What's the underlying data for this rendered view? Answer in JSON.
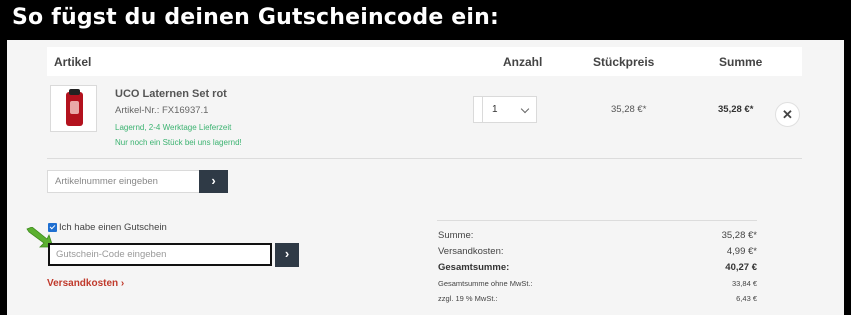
{
  "banner": {
    "title": "So fügst du deinen Gutscheincode ein:"
  },
  "table": {
    "headers": {
      "article": "Artikel",
      "quantity": "Anzahl",
      "unit_price": "Stückpreis",
      "total": "Summe"
    }
  },
  "item": {
    "name": "UCO Laternen Set rot",
    "article_number": "Artikel-Nr.: FX16937.1",
    "stock_status": "Lagernd, 2-4 Werktage Lieferzeit",
    "last_item_note": "Nur noch ein Stück bei uns lagernd!",
    "quantity": "1",
    "unit_price": "35,28 €*",
    "line_total": "35,28 €*",
    "remove_symbol": "✕"
  },
  "article_search": {
    "placeholder": "Artikelnummer eingeben",
    "button_symbol": "›"
  },
  "voucher": {
    "checkbox_label": "Ich habe einen Gutschein",
    "checked": true,
    "placeholder": "Gutschein-Code eingeben",
    "button_symbol": "›"
  },
  "shipping_link": "Versandkosten ›",
  "summary": [
    {
      "label": "Summe:",
      "value": "35,28 €*"
    },
    {
      "label": "Versandkosten:",
      "value": "4,99 €*"
    },
    {
      "label": "Gesamtsumme:",
      "value": "40,27 €"
    },
    {
      "label": "Gesamtsumme ohne MwSt.:",
      "value": "33,84 €"
    },
    {
      "label": "zzgl. 19 % MwSt.:",
      "value": "6,43 €"
    }
  ],
  "colors": {
    "accent_green": "#3cb371",
    "button_dark": "#2f3a46",
    "link_red": "#c0392b",
    "arrow_green": "#5bb030"
  },
  "icons": {
    "arrow": "pointing-arrow-icon",
    "remove": "close-icon",
    "chevron": "chevron-down-icon",
    "submit": "chevron-right-icon"
  }
}
